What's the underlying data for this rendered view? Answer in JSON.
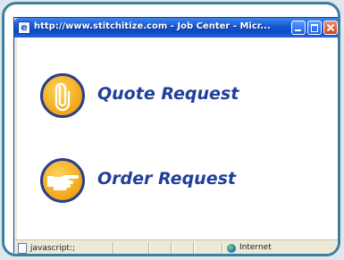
{
  "window": {
    "title": "http://www.stitchitize.com - Job Center - Micr...",
    "ie_icon_glyph": "e"
  },
  "menu": {
    "quote": {
      "label": "Quote Request",
      "icon": "paperclip-icon"
    },
    "order": {
      "label": "Order Request",
      "icon": "pointing-hand-icon"
    }
  },
  "statusbar": {
    "left_text": "javascript:;",
    "zone_text": "Internet",
    "zone_icon": "globe-icon"
  },
  "colors": {
    "label_blue": "#20409a",
    "icon_gold": "#f0a617",
    "icon_ring": "#2a3f8a",
    "frame_teal": "#3f7f9e"
  }
}
